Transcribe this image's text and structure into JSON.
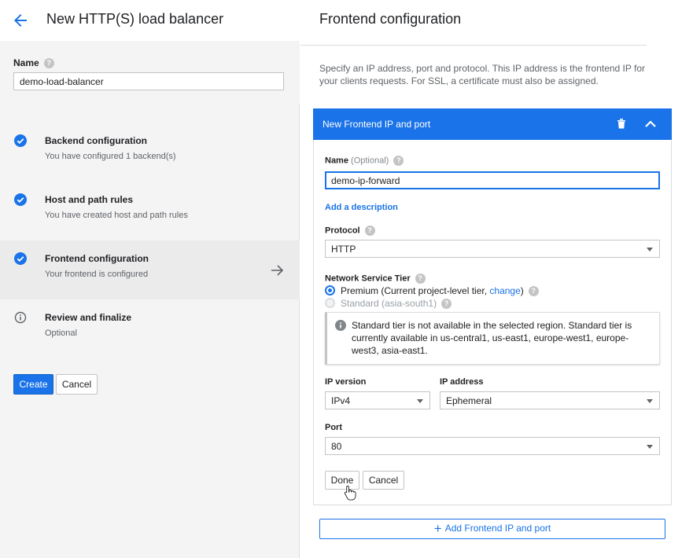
{
  "header": {
    "title": "New HTTP(S) load balancer"
  },
  "name_field": {
    "label": "Name",
    "value": "demo-load-balancer"
  },
  "steps": [
    {
      "title": "Backend configuration",
      "subtitle": "You have configured 1 backend(s)",
      "status": "done"
    },
    {
      "title": "Host and path rules",
      "subtitle": "You have created host and path rules",
      "status": "done"
    },
    {
      "title": "Frontend configuration",
      "subtitle": "Your frontend is configured",
      "status": "done"
    },
    {
      "title": "Review and finalize",
      "subtitle": "Optional",
      "status": "info"
    }
  ],
  "actions": {
    "create": "Create",
    "cancel": "Cancel"
  },
  "frontend": {
    "title": "Frontend configuration",
    "description": "Specify an IP address, port and protocol. This IP address is the frontend IP for your clients requests. For SSL, a certificate must also be assigned.",
    "panel_title": "New Frontend IP and port",
    "name_label": "Name",
    "name_optional": "(Optional)",
    "name_value": "demo-ip-forward",
    "add_description": "Add a description",
    "protocol_label": "Protocol",
    "protocol_value": "HTTP",
    "tier_label": "Network Service Tier",
    "tier_premium": "Premium (Current project-level tier, ",
    "tier_change": "change",
    "tier_premium_end": ")",
    "tier_standard": "Standard (asia-south1)",
    "info_text": "Standard tier is not available in the selected region. Standard tier is currently available in us-central1, us-east1, europe-west1, europe-west3, asia-east1.",
    "ip_version_label": "IP version",
    "ip_version_value": "IPv4",
    "ip_address_label": "IP address",
    "ip_address_value": "Ephemeral",
    "port_label": "Port",
    "port_value": "80",
    "done": "Done",
    "cancel": "Cancel",
    "add_button": "Add Frontend IP and port"
  },
  "colors": {
    "accent": "#1a73e8",
    "sidebar_bg": "#f4f4f4"
  }
}
